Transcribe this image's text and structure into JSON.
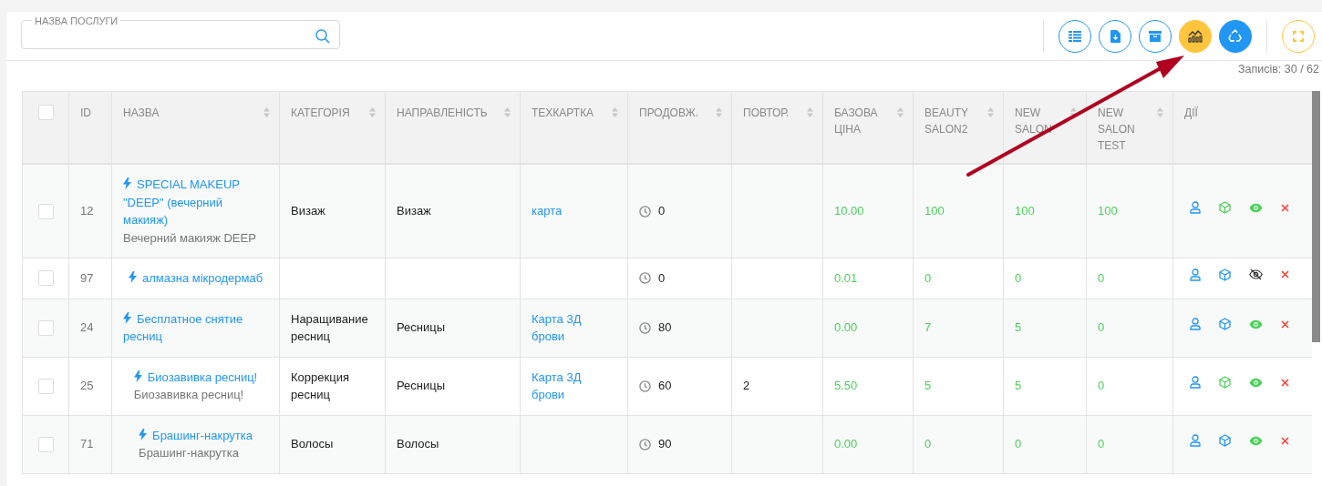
{
  "search": {
    "label": "НАЗВА ПОСЛУГИ"
  },
  "toolbar": [
    {
      "kind": "columns"
    },
    {
      "kind": "export"
    },
    {
      "kind": "archive"
    },
    {
      "kind": "chart"
    },
    {
      "kind": "recycle"
    },
    {
      "kind": "fullscreen"
    }
  ],
  "records": "Записів: 30 / 62",
  "table": {
    "select_all_checked": false,
    "columns": [
      {
        "label": "ID",
        "sortable": false
      },
      {
        "label": "НАЗВА",
        "sortable": true
      },
      {
        "label": "КАТЕГОРІЯ",
        "sortable": true
      },
      {
        "label": "НАПРАВЛЕНІСТЬ",
        "sortable": true
      },
      {
        "label": "ТЕХКАРТКА",
        "sortable": true
      },
      {
        "label": "ПРОДОВЖ.",
        "sortable": true
      },
      {
        "label": "ПОВТОР.",
        "sortable": true
      },
      {
        "label": "БАЗОВА ЦІНА",
        "sortable": true
      },
      {
        "label": "BEAUTY SALON2",
        "sortable": true
      },
      {
        "label": "NEW SALON",
        "sortable": true
      },
      {
        "label": "NEW SALON TEST",
        "sortable": true
      },
      {
        "label": "ДІЇ",
        "sortable": false
      }
    ],
    "rows": [
      {
        "checked": false,
        "id": "12",
        "name": "SPECIAL MAKEUP \"DEEP\" (вечерний макияж)",
        "subtitle": "Вечерний макияж DEEP",
        "category": "Визаж",
        "direction": "Визаж",
        "techcard": "карта",
        "duration": "0",
        "repeat": "",
        "base_price": "10.00",
        "beauty_salon2": "100",
        "new_salon": "100",
        "new_salon_test": "100",
        "cube_active": true,
        "visible": true
      },
      {
        "checked": false,
        "id": "97",
        "name": "алмазна мікродермаб",
        "subtitle": "",
        "category": "",
        "direction": "",
        "techcard": "",
        "duration": "0",
        "repeat": "",
        "base_price": "0.01",
        "beauty_salon2": "0",
        "new_salon": "0",
        "new_salon_test": "0",
        "cube_active": false,
        "visible": false
      },
      {
        "checked": false,
        "id": "24",
        "name": "Бесплатное снятие ресниц",
        "subtitle": "",
        "category": "Наращивание ресниц",
        "direction": "Ресницы",
        "techcard": "Карта 3Д брови",
        "duration": "80",
        "repeat": "",
        "base_price": "0.00",
        "beauty_salon2": "7",
        "new_salon": "5",
        "new_salon_test": "0",
        "cube_active": false,
        "visible": true
      },
      {
        "checked": false,
        "id": "25",
        "name": "Биозавивка ресниц!",
        "subtitle": "Биозавивка ресниц!",
        "category": "Коррекция ресниц",
        "direction": "Ресницы",
        "techcard": "Карта 3Д брови",
        "duration": "60",
        "repeat": "2",
        "base_price": "5.50",
        "beauty_salon2": "5",
        "new_salon": "5",
        "new_salon_test": "0",
        "cube_active": true,
        "visible": true
      },
      {
        "checked": false,
        "id": "71",
        "name": "Брашинг-накрутка",
        "subtitle": "Брашинг-накрутка",
        "category": "Волосы",
        "direction": "Волосы",
        "techcard": "",
        "duration": "90",
        "repeat": "",
        "base_price": "0.00",
        "beauty_salon2": "0",
        "new_salon": "0",
        "new_salon_test": "0",
        "cube_active": false,
        "visible": true
      }
    ]
  }
}
